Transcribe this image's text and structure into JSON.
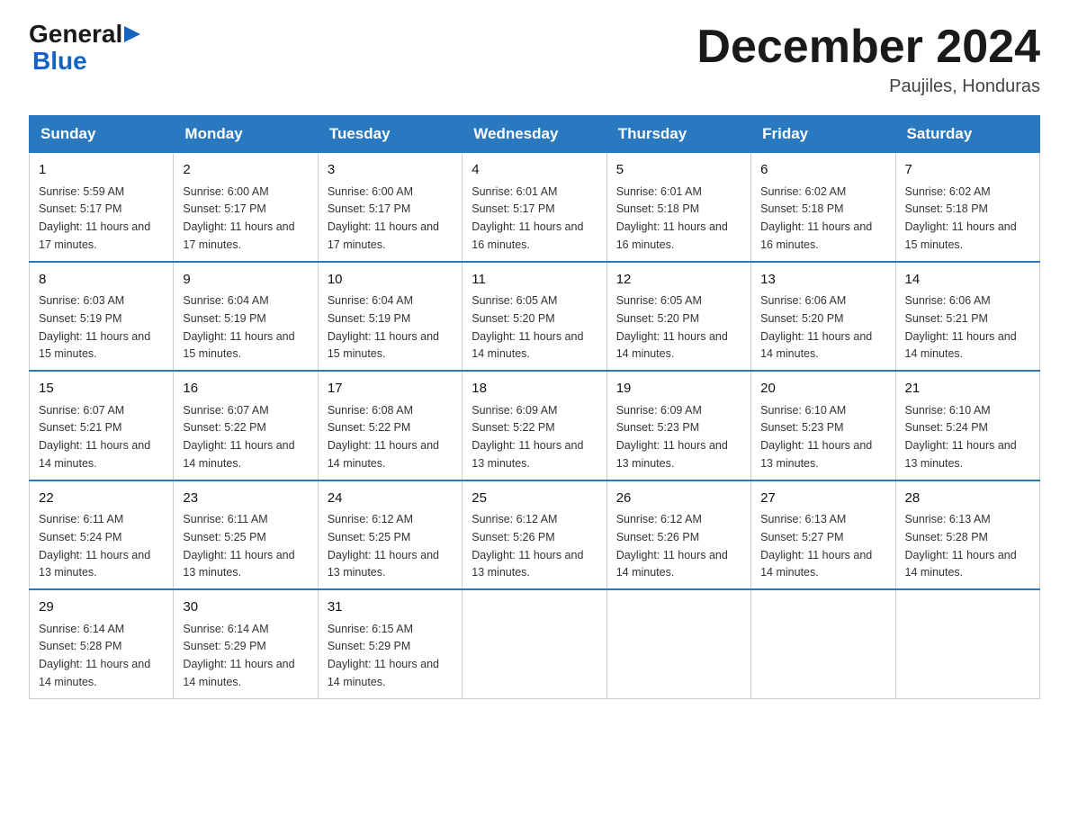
{
  "header": {
    "logo_general": "General",
    "logo_blue": "Blue",
    "title": "December 2024",
    "subtitle": "Paujiles, Honduras"
  },
  "calendar": {
    "headers": [
      "Sunday",
      "Monday",
      "Tuesday",
      "Wednesday",
      "Thursday",
      "Friday",
      "Saturday"
    ],
    "weeks": [
      [
        {
          "day": "1",
          "sunrise": "5:59 AM",
          "sunset": "5:17 PM",
          "daylight": "11 hours and 17 minutes."
        },
        {
          "day": "2",
          "sunrise": "6:00 AM",
          "sunset": "5:17 PM",
          "daylight": "11 hours and 17 minutes."
        },
        {
          "day": "3",
          "sunrise": "6:00 AM",
          "sunset": "5:17 PM",
          "daylight": "11 hours and 17 minutes."
        },
        {
          "day": "4",
          "sunrise": "6:01 AM",
          "sunset": "5:17 PM",
          "daylight": "11 hours and 16 minutes."
        },
        {
          "day": "5",
          "sunrise": "6:01 AM",
          "sunset": "5:18 PM",
          "daylight": "11 hours and 16 minutes."
        },
        {
          "day": "6",
          "sunrise": "6:02 AM",
          "sunset": "5:18 PM",
          "daylight": "11 hours and 16 minutes."
        },
        {
          "day": "7",
          "sunrise": "6:02 AM",
          "sunset": "5:18 PM",
          "daylight": "11 hours and 15 minutes."
        }
      ],
      [
        {
          "day": "8",
          "sunrise": "6:03 AM",
          "sunset": "5:19 PM",
          "daylight": "11 hours and 15 minutes."
        },
        {
          "day": "9",
          "sunrise": "6:04 AM",
          "sunset": "5:19 PM",
          "daylight": "11 hours and 15 minutes."
        },
        {
          "day": "10",
          "sunrise": "6:04 AM",
          "sunset": "5:19 PM",
          "daylight": "11 hours and 15 minutes."
        },
        {
          "day": "11",
          "sunrise": "6:05 AM",
          "sunset": "5:20 PM",
          "daylight": "11 hours and 14 minutes."
        },
        {
          "day": "12",
          "sunrise": "6:05 AM",
          "sunset": "5:20 PM",
          "daylight": "11 hours and 14 minutes."
        },
        {
          "day": "13",
          "sunrise": "6:06 AM",
          "sunset": "5:20 PM",
          "daylight": "11 hours and 14 minutes."
        },
        {
          "day": "14",
          "sunrise": "6:06 AM",
          "sunset": "5:21 PM",
          "daylight": "11 hours and 14 minutes."
        }
      ],
      [
        {
          "day": "15",
          "sunrise": "6:07 AM",
          "sunset": "5:21 PM",
          "daylight": "11 hours and 14 minutes."
        },
        {
          "day": "16",
          "sunrise": "6:07 AM",
          "sunset": "5:22 PM",
          "daylight": "11 hours and 14 minutes."
        },
        {
          "day": "17",
          "sunrise": "6:08 AM",
          "sunset": "5:22 PM",
          "daylight": "11 hours and 14 minutes."
        },
        {
          "day": "18",
          "sunrise": "6:09 AM",
          "sunset": "5:22 PM",
          "daylight": "11 hours and 13 minutes."
        },
        {
          "day": "19",
          "sunrise": "6:09 AM",
          "sunset": "5:23 PM",
          "daylight": "11 hours and 13 minutes."
        },
        {
          "day": "20",
          "sunrise": "6:10 AM",
          "sunset": "5:23 PM",
          "daylight": "11 hours and 13 minutes."
        },
        {
          "day": "21",
          "sunrise": "6:10 AM",
          "sunset": "5:24 PM",
          "daylight": "11 hours and 13 minutes."
        }
      ],
      [
        {
          "day": "22",
          "sunrise": "6:11 AM",
          "sunset": "5:24 PM",
          "daylight": "11 hours and 13 minutes."
        },
        {
          "day": "23",
          "sunrise": "6:11 AM",
          "sunset": "5:25 PM",
          "daylight": "11 hours and 13 minutes."
        },
        {
          "day": "24",
          "sunrise": "6:12 AM",
          "sunset": "5:25 PM",
          "daylight": "11 hours and 13 minutes."
        },
        {
          "day": "25",
          "sunrise": "6:12 AM",
          "sunset": "5:26 PM",
          "daylight": "11 hours and 13 minutes."
        },
        {
          "day": "26",
          "sunrise": "6:12 AM",
          "sunset": "5:26 PM",
          "daylight": "11 hours and 14 minutes."
        },
        {
          "day": "27",
          "sunrise": "6:13 AM",
          "sunset": "5:27 PM",
          "daylight": "11 hours and 14 minutes."
        },
        {
          "day": "28",
          "sunrise": "6:13 AM",
          "sunset": "5:28 PM",
          "daylight": "11 hours and 14 minutes."
        }
      ],
      [
        {
          "day": "29",
          "sunrise": "6:14 AM",
          "sunset": "5:28 PM",
          "daylight": "11 hours and 14 minutes."
        },
        {
          "day": "30",
          "sunrise": "6:14 AM",
          "sunset": "5:29 PM",
          "daylight": "11 hours and 14 minutes."
        },
        {
          "day": "31",
          "sunrise": "6:15 AM",
          "sunset": "5:29 PM",
          "daylight": "11 hours and 14 minutes."
        },
        null,
        null,
        null,
        null
      ]
    ]
  }
}
